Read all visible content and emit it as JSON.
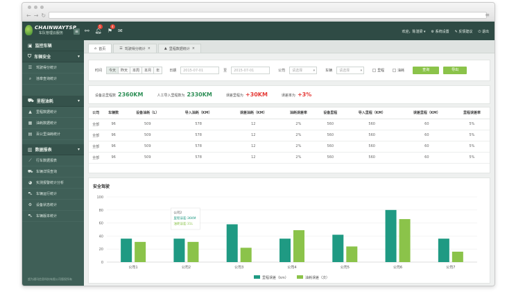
{
  "brand": {
    "title": "CHAINWAYTSP",
    "subtitle": "车队管理云服务"
  },
  "topbar": {
    "badges": [
      "5",
      "4"
    ],
    "welcome": "欢迎，陈湛梁 ▾",
    "settings": "系统设置",
    "feedback": "反馈建议",
    "logout": "退出"
  },
  "sidebar": {
    "groups": [
      {
        "label": "监控车辆",
        "icon": "map-icon",
        "items": []
      },
      {
        "label": "车辆安全",
        "icon": "shield-icon",
        "items": [
          "驾驶得分统计",
          "违章查询统计"
        ]
      },
      {
        "label": "里程油耗",
        "icon": "road-icon",
        "items": [
          "里程数据统计",
          "油耗数据统计",
          "百公里油耗统计"
        ]
      },
      {
        "label": "数据报表",
        "icon": "chart-icon",
        "items": [
          "行车数据报表",
          "车辆详情查询",
          "实测报警统计分析",
          "车辆运行统计",
          "设备状态统计",
          "车辆版本统计"
        ]
      }
    ],
    "footer": "超为通讯信息科技有限公司版权所有"
  },
  "tabs": [
    {
      "label": "首页",
      "icon": "home-icon"
    },
    {
      "label": "驾驶得分统计",
      "icon": "list-icon"
    },
    {
      "label": "里程数据统计",
      "icon": "road-icon"
    }
  ],
  "filters": {
    "time_label": "时间",
    "ranges": [
      "今天",
      "昨天",
      "本周",
      "本月",
      "年"
    ],
    "date_label": "日期",
    "date_from": "2015-07-01",
    "to_label": "至",
    "date_to": "2015-07-01",
    "company_label": "公司",
    "company_placeholder": "请选择",
    "vehicle_label": "车辆",
    "vehicle_placeholder": "请选择",
    "mileage_check": "里程",
    "fuel_check": "油耗",
    "search_button": "查询",
    "export_button": "导出"
  },
  "summary": [
    {
      "label": "设备总里程数",
      "value": "2360KM",
      "tone": "green"
    },
    {
      "label": "人工导入里程数为",
      "value": "2330KM",
      "tone": "green"
    },
    {
      "label": "误差里程为",
      "value": "+30KM",
      "tone": "red"
    },
    {
      "label": "误差率为",
      "value": "+3%",
      "tone": "red"
    }
  ],
  "table": {
    "headers": [
      "公司",
      "车辆数",
      "设备油耗（L）",
      "导入油耗（KM）",
      "误差油耗（KM）",
      "油耗误差率",
      "设备里程",
      "导入里程（KM）",
      "误差里程（KM）",
      "里程误差率"
    ],
    "rows": [
      [
        "全部",
        "96",
        "509",
        "578",
        "12",
        "2%",
        "560",
        "560",
        "60",
        "5%"
      ],
      [
        "全部",
        "96",
        "509",
        "578",
        "12",
        "2%",
        "560",
        "560",
        "60",
        "5%"
      ],
      [
        "全部",
        "96",
        "509",
        "578",
        "12",
        "2%",
        "560",
        "560",
        "60",
        "5%"
      ],
      [
        "全部",
        "96",
        "509",
        "578",
        "12",
        "2%",
        "560",
        "560",
        "60",
        "5%"
      ]
    ]
  },
  "chart_title": "安全驾驶",
  "tooltip": {
    "title": "公司2",
    "line1": "里程误差:36KM",
    "line2": "油耗误差:31L"
  },
  "chart_data": {
    "type": "bar",
    "title": "安全驾驶",
    "categories": [
      "公司1",
      "公司2",
      "公司3",
      "公司4",
      "公司5",
      "公司6",
      "公司7"
    ],
    "series": [
      {
        "name": "里程误差（km）",
        "color": "#1f9a83",
        "values": [
          36,
          36,
          58,
          36,
          42,
          80,
          36
        ]
      },
      {
        "name": "油耗误差（次）",
        "color": "#8bc34a",
        "values": [
          31,
          31,
          22,
          49,
          24,
          66,
          16
        ]
      }
    ],
    "yticks": [
      0,
      20,
      40,
      60,
      80,
      100
    ],
    "ylim": [
      0,
      100
    ],
    "legend": "bottom-center"
  }
}
